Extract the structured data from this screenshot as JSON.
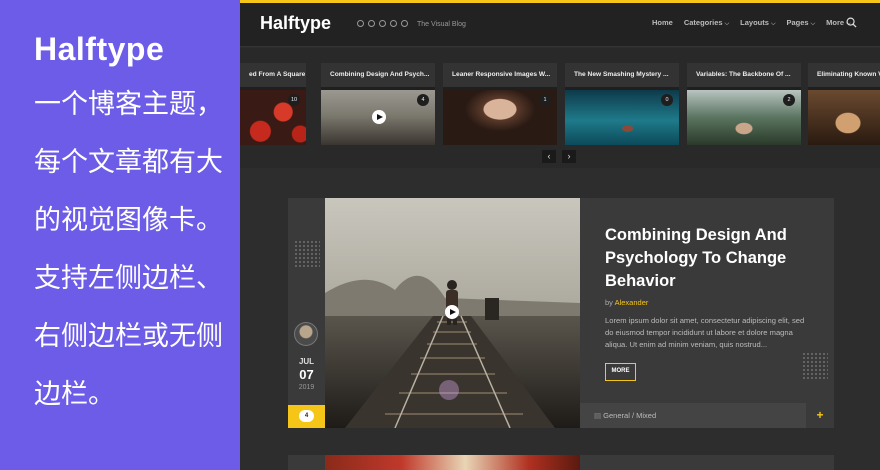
{
  "promo": {
    "title": "Halftype",
    "description": "一个博客主题，每个文章都有大的视觉图像卡。支持左侧边栏、右侧边栏或无侧边栏。"
  },
  "header": {
    "logo": "Halftype",
    "tagline": "The Visual Blog",
    "socials": [
      "facebook-icon",
      "twitter-icon",
      "instagram-icon",
      "pinterest-icon",
      "snapchat-icon"
    ],
    "nav": [
      {
        "label": "Home",
        "dropdown": false
      },
      {
        "label": "Categories",
        "dropdown": true
      },
      {
        "label": "Layouts",
        "dropdown": true
      },
      {
        "label": "Pages",
        "dropdown": true
      },
      {
        "label": "More",
        "dropdown": true
      }
    ]
  },
  "slider": {
    "cards": [
      {
        "title": "ed From A Square ...",
        "count": "10",
        "video": false
      },
      {
        "title": "Combining Design And Psych...",
        "count": "4",
        "video": true
      },
      {
        "title": "Leaner Responsive Images W...",
        "count": "1",
        "video": false
      },
      {
        "title": "The New Smashing Mystery ...",
        "count": "0",
        "video": false
      },
      {
        "title": "Variables: The Backbone Of ...",
        "count": "2",
        "video": false
      },
      {
        "title": "Eliminating Known V",
        "count": "",
        "video": false
      }
    ]
  },
  "featured": {
    "title": "Combining Design And Psychology To Change Behavior",
    "by": "by",
    "author": "Alexander",
    "excerpt": "Lorem ipsum dolor sit amet, consectetur adipiscing elit, sed do eiusmod tempor incididunt ut labore et dolore magna aliqua. Ut enim ad minim veniam, quis nostrud...",
    "more_label": "MORE",
    "month": "JUL",
    "day": "07",
    "year": "2019",
    "comments": "4",
    "category": "General / Mixed"
  },
  "colors": {
    "accent": "#f5c518",
    "promo_bg": "#6c5ce7",
    "site_bg": "#2d2d2d"
  }
}
